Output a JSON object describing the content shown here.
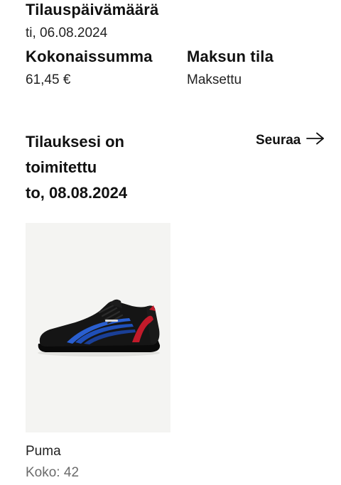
{
  "order": {
    "date_label": "Tilauspäivämäärä",
    "date_value": "ti, 06.08.2024",
    "total_label": "Kokonaissumma",
    "total_value": "61,45 €",
    "payment_label": "Maksun tila",
    "payment_value": "Maksettu"
  },
  "delivery": {
    "status_line1": "Tilauksesi on",
    "status_line2": "toimitettu",
    "status_date": "to, 08.08.2024",
    "follow_label": "Seuraa"
  },
  "product": {
    "brand": "Puma",
    "size_label": "Koko:",
    "size_value": "42",
    "colors": {
      "shoe_body": "#151515",
      "stripe_blue": "#1f4fb8",
      "stripe_red": "#c21a2a",
      "sole": "#0a0a0a",
      "background": "#f4f4f2"
    }
  }
}
